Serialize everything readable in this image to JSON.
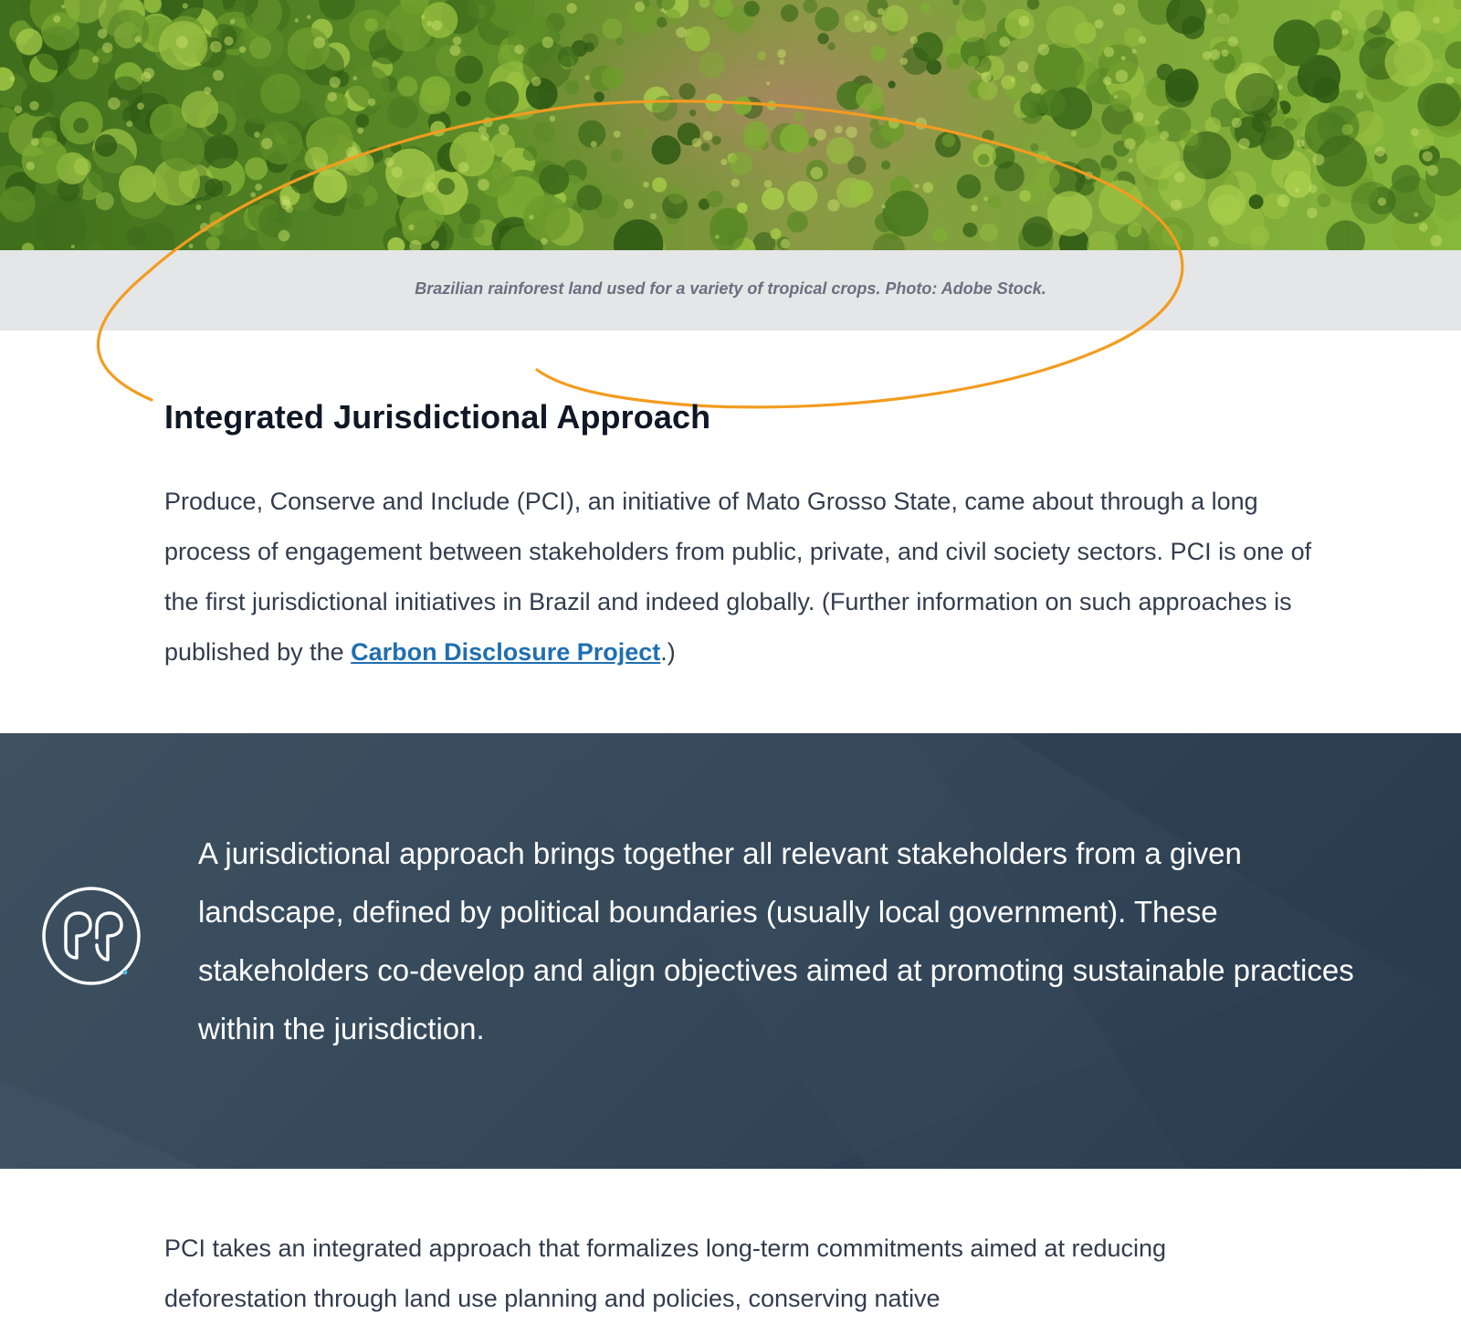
{
  "hero": {
    "caption": "Brazilian rainforest land used for a variety of tropical crops. Photo: Adobe Stock."
  },
  "section": {
    "heading": "Integrated Jurisdictional Approach",
    "paragraph_main": "Produce, Conserve and Include (PCI), an initiative of Mato Grosso State, came about through a long process of engagement between stakeholders from public, private, and civil society sectors. PCI is one of the first jurisdictional initiatives in Brazil and indeed globally. (Further information on such approaches is published by the ",
    "link_text": "Carbon Disclosure Project",
    "paragraph_end": ".)"
  },
  "quote": {
    "icon": "quote-marks-icon",
    "text": "A jurisdictional approach brings together all relevant stakeholders from a given landscape, defined by political boundaries (usually local government). These stakeholders co-develop and align objectives aimed at promoting sustainable practices within the jurisdiction."
  },
  "body": {
    "paragraph_2": "PCI takes an integrated approach that formalizes long-term commitments aimed at reducing deforestation through land use planning and policies, conserving native"
  },
  "colors": {
    "accent_orange": "#f39c1f",
    "link_blue": "#1f6fb1",
    "quote_band": "#34485a",
    "caption_bg": "#e5e6e8"
  }
}
